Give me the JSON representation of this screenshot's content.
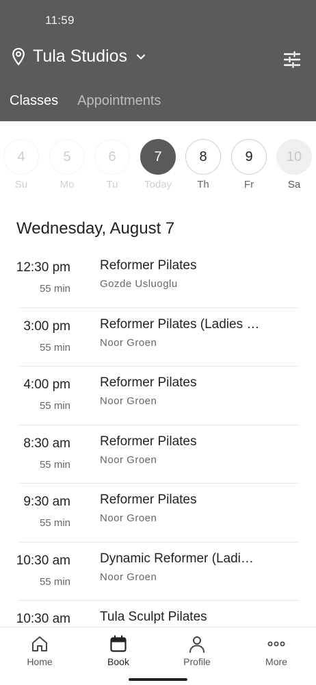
{
  "status": {
    "time": "11:59"
  },
  "header": {
    "studio_name": "Tula Studios",
    "location_icon": "map-pin-icon",
    "dropdown_icon": "chevron-down-icon",
    "filter_icon": "sliders-icon",
    "tabs": [
      {
        "label": "Classes",
        "active": true
      },
      {
        "label": "Appointments",
        "active": false
      }
    ]
  },
  "days": [
    {
      "num": "4",
      "label": "Su",
      "state": "past"
    },
    {
      "num": "5",
      "label": "Mo",
      "state": "past"
    },
    {
      "num": "6",
      "label": "Tu",
      "state": "past"
    },
    {
      "num": "7",
      "label": "Today",
      "state": "selected"
    },
    {
      "num": "8",
      "label": "Th",
      "state": "future"
    },
    {
      "num": "9",
      "label": "Fr",
      "state": "future"
    },
    {
      "num": "10",
      "label": "Sa",
      "state": "disabled"
    }
  ],
  "date_heading": "Wednesday, August 7",
  "classes": [
    {
      "time": "12:30 pm",
      "duration": "55 min",
      "name": "Reformer Pilates",
      "instructor": "Gozde Usluoglu"
    },
    {
      "time": "3:00 pm",
      "duration": "55 min",
      "name": "Reformer Pilates (Ladies …",
      "instructor": "Noor Groen"
    },
    {
      "time": "4:00 pm",
      "duration": "55 min",
      "name": "Reformer Pilates",
      "instructor": "Noor Groen"
    },
    {
      "time": "8:30 am",
      "duration": "55 min",
      "name": "Reformer Pilates",
      "instructor": "Noor Groen"
    },
    {
      "time": "9:30 am",
      "duration": "55 min",
      "name": "Reformer Pilates",
      "instructor": "Noor Groen"
    },
    {
      "time": "10:30 am",
      "duration": "55 min",
      "name": "Dynamic Reformer (Ladi…",
      "instructor": "Noor Groen"
    },
    {
      "time": "10:30 am",
      "duration": "",
      "name": "Tula Sculpt Pilates",
      "instructor": ""
    }
  ],
  "nav": [
    {
      "label": "Home",
      "icon": "home-icon",
      "active": false
    },
    {
      "label": "Book",
      "icon": "calendar-icon",
      "active": true
    },
    {
      "label": "Profile",
      "icon": "profile-icon",
      "active": false
    },
    {
      "label": "More",
      "icon": "more-icon",
      "active": false
    }
  ],
  "colors": {
    "header_bg": "#5b5b5b",
    "selected_day": "#5a5a5a"
  }
}
